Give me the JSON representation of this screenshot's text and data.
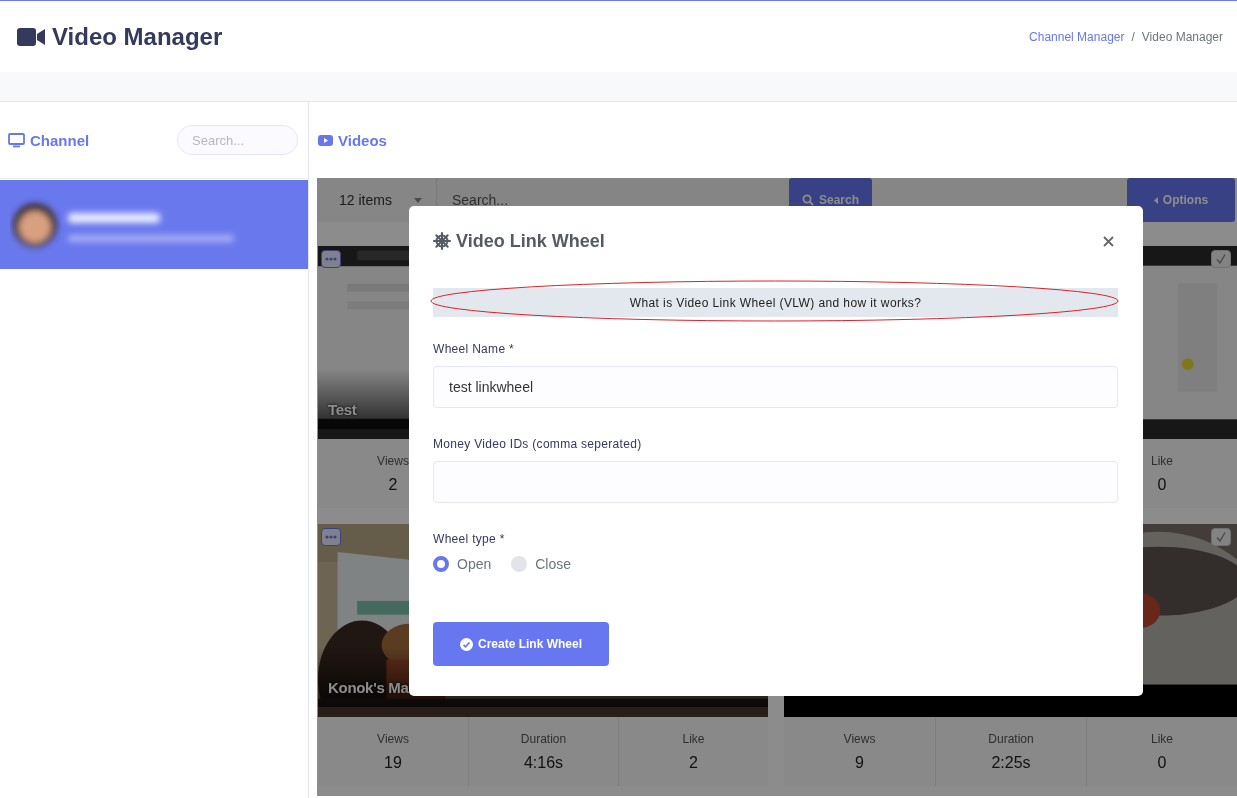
{
  "header": {
    "title": "Video Manager",
    "breadcrumbs": [
      {
        "label": "Channel Manager",
        "kind": "link"
      },
      {
        "label": "Video Manager",
        "kind": "current"
      }
    ],
    "separator": "/"
  },
  "sidebar": {
    "title": "Channel",
    "search": {
      "placeholder": "Search..."
    },
    "channels": [
      {
        "selected": true
      }
    ]
  },
  "videos": {
    "title": "Videos",
    "toolbar": {
      "page_size": "12 items",
      "search": {
        "placeholder": "Search..."
      },
      "search_button": "Search",
      "options_button": "Options"
    },
    "cards": [
      {
        "title": "Test",
        "kind": "menu",
        "stats": [
          {
            "kind": "views",
            "label": "Views",
            "value": "2"
          }
        ]
      },
      {
        "kind": "checkbox",
        "checked": false,
        "stats": [
          {
            "kind": "like",
            "label": "Like",
            "value": "0"
          }
        ]
      },
      {
        "title": "Konok's Ma",
        "kind": "menu",
        "stats": [
          {
            "kind": "views",
            "label": "Views",
            "value": "19"
          },
          {
            "kind": "duration",
            "label": "Duration",
            "value": "4:16s"
          },
          {
            "kind": "like",
            "label": "Like",
            "value": "2"
          }
        ]
      },
      {
        "kind": "checkbox",
        "checked": false,
        "stats": [
          {
            "kind": "views",
            "label": "Views",
            "value": "9"
          },
          {
            "kind": "duration",
            "label": "Duration",
            "value": "2:25s"
          },
          {
            "kind": "like",
            "label": "Like",
            "value": "0"
          }
        ]
      }
    ]
  },
  "modal": {
    "title": "Video Link Wheel",
    "info": "What is Video Link Wheel (VLW) and how it works?",
    "fields": [
      {
        "label": "Wheel Name *",
        "value": "test linkwheel"
      },
      {
        "label": "Money Video IDs (comma seperated)"
      }
    ],
    "wheel_type": {
      "label": "Wheel type *",
      "options": [
        {
          "label": "Open",
          "selected": true
        },
        {
          "label": "Close",
          "selected": false
        }
      ]
    },
    "submit": "Create Link Wheel"
  }
}
